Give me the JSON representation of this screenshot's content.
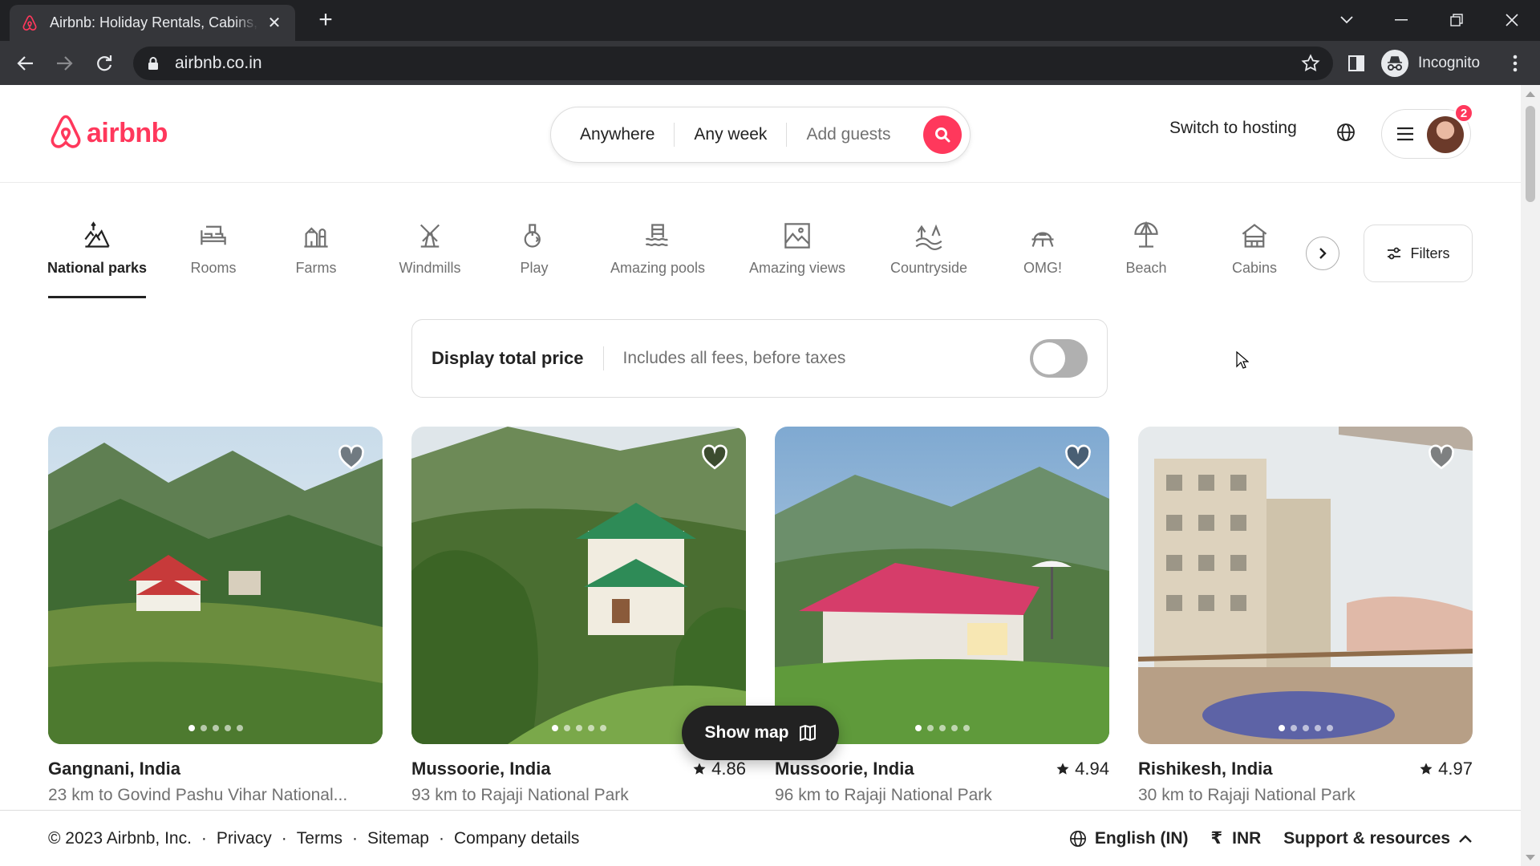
{
  "browser": {
    "tab_title": "Airbnb: Holiday Rentals, Cabins, Beach Houses & More",
    "url": "airbnb.co.in",
    "profile_label": "Incognito"
  },
  "header": {
    "logo_text": "airbnb",
    "search": {
      "where": "Anywhere",
      "when": "Any week",
      "who": "Add guests"
    },
    "switch_hosting": "Switch to hosting",
    "notification_count": "2"
  },
  "categories": [
    {
      "label": "National parks",
      "icon": "national-parks-icon",
      "active": true
    },
    {
      "label": "Rooms",
      "icon": "rooms-icon"
    },
    {
      "label": "Farms",
      "icon": "farms-icon"
    },
    {
      "label": "Windmills",
      "icon": "windmills-icon"
    },
    {
      "label": "Play",
      "icon": "play-icon"
    },
    {
      "label": "Amazing pools",
      "icon": "amazing-pools-icon"
    },
    {
      "label": "Amazing views",
      "icon": "amazing-views-icon"
    },
    {
      "label": "Countryside",
      "icon": "countryside-icon"
    },
    {
      "label": "OMG!",
      "icon": "omg-icon"
    },
    {
      "label": "Beach",
      "icon": "beach-icon"
    },
    {
      "label": "Cabins",
      "icon": "cabins-icon"
    }
  ],
  "filters_label": "Filters",
  "total_price": {
    "title": "Display total price",
    "subtitle": "Includes all fees, before taxes",
    "enabled": false
  },
  "listings": [
    {
      "title": "Gangnani, India",
      "subtitle": "23 km to Govind Pashu Vihar National...",
      "rating": ""
    },
    {
      "title": "Mussoorie, India",
      "subtitle": "93 km to Rajaji National Park",
      "rating": "4.86"
    },
    {
      "title": "Mussoorie, India",
      "subtitle": "96 km to Rajaji National Park",
      "rating": "4.94"
    },
    {
      "title": "Rishikesh, India",
      "subtitle": "30 km to Rajaji National Park",
      "rating": "4.97"
    }
  ],
  "show_map": "Show map",
  "footer": {
    "copyright": "© 2023 Airbnb, Inc.",
    "links": [
      "Privacy",
      "Terms",
      "Sitemap",
      "Company details"
    ],
    "language": "English (IN)",
    "currency_symbol": "₹",
    "currency": "INR",
    "support": "Support & resources"
  },
  "colors": {
    "brand": "#ff385c",
    "text": "#222222",
    "muted": "#717171",
    "border": "#dddddd"
  }
}
